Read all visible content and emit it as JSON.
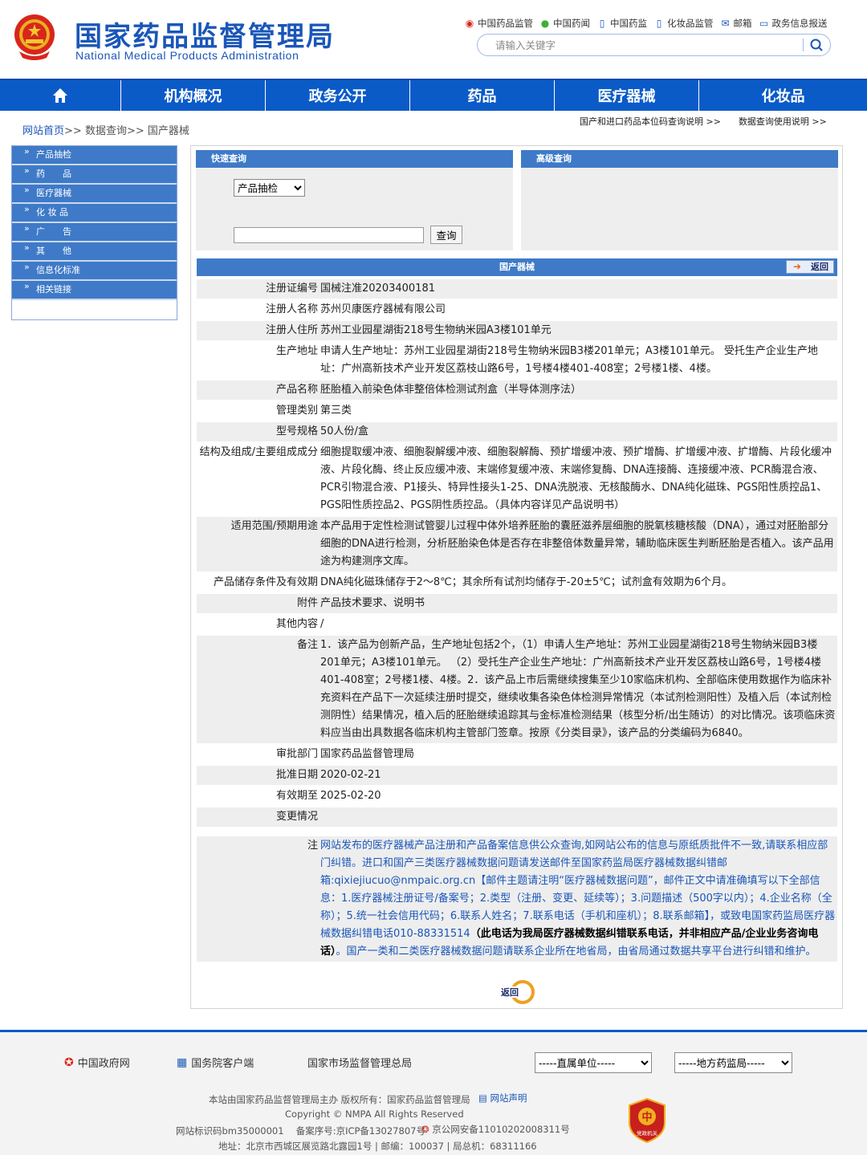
{
  "header": {
    "title_cn": "国家药品监督管理局",
    "title_en": "National Medical Products Administration",
    "top_links": [
      {
        "icon": "weibo-icon",
        "label": "中国药品监管"
      },
      {
        "icon": "wechat-icon",
        "label": "中国药闻"
      },
      {
        "icon": "phone-icon",
        "label": "中国药监"
      },
      {
        "icon": "phone-icon",
        "label": "化妆品监管"
      },
      {
        "icon": "mail-icon",
        "label": "邮箱"
      },
      {
        "icon": "monitor-icon",
        "label": "政务信息报送"
      }
    ],
    "search_placeholder": "请输入关键字"
  },
  "nav": {
    "items": [
      "机构概况",
      "政务公开",
      "药品",
      "医疗器械",
      "化妆品"
    ]
  },
  "breadcrumb": {
    "home": "网站首页",
    "sep": ">>",
    "level2": "数据查询",
    "level3": "国产器械"
  },
  "help_links": [
    "国产和进口药品本位码查询说明 >>",
    "数据查询使用说明 >>"
  ],
  "left_menu": [
    "产品抽检",
    "药　　品",
    "医疗器械",
    "化 妆 品",
    "广　　告",
    "其　　他",
    "信息化标准",
    "相关链接"
  ],
  "quick_search": {
    "title": "快速查询",
    "select_value": "产品抽检",
    "button": "查询"
  },
  "advanced_search": {
    "title": "高级查询"
  },
  "detail": {
    "title": "国产器械",
    "back_label": "返回",
    "rows": [
      {
        "label": "注册证编号",
        "value": "国械注准20203400181"
      },
      {
        "label": "注册人名称",
        "value": "苏州贝康医疗器械有限公司"
      },
      {
        "label": "注册人住所",
        "value": "苏州工业园星湖街218号生物纳米园A3楼101单元"
      },
      {
        "label": "生产地址",
        "value": "申请人生产地址：苏州工业园星湖街218号生物纳米园B3楼201单元；A3楼101单元。 受托生产企业生产地址：广州高新技术产业开发区荔枝山路6号，1号楼4楼401-408室；2号楼1楼、4楼。"
      },
      {
        "label": "产品名称",
        "value": "胚胎植入前染色体非整倍体检测试剂盒（半导体测序法）"
      },
      {
        "label": "管理类别",
        "value": "第三类"
      },
      {
        "label": "型号规格",
        "value": "50人份/盒"
      },
      {
        "label": "结构及组成/主要组成成分",
        "value": "细胞提取缓冲液、细胞裂解缓冲液、细胞裂解酶、预扩增缓冲液、预扩增酶、扩增缓冲液、扩增酶、片段化缓冲液、片段化酶、终止反应缓冲液、末端修复缓冲液、末端修复酶、DNA连接酶、连接缓冲液、PCR酶混合液、PCR引物混合液、P1接头、特异性接头1-25、DNA洗脱液、无核酸酶水、DNA纯化磁珠、PGS阳性质控品1、PGS阳性质控品2、PGS阴性质控品。（具体内容详见产品说明书）"
      },
      {
        "label": "适用范围/预期用途",
        "value": "本产品用于定性检测试管婴儿过程中体外培养胚胎的囊胚滋养层细胞的脱氧核糖核酸（DNA），通过对胚胎部分细胞的DNA进行检测，分析胚胎染色体是否存在非整倍体数量异常，辅助临床医生判断胚胎是否植入。该产品用途为构建测序文库。"
      },
      {
        "label": "产品储存条件及有效期",
        "value": "DNA纯化磁珠储存于2～8℃；其余所有试剂均储存于-20±5℃；试剂盒有效期为6个月。"
      },
      {
        "label": "附件",
        "value": "产品技术要求、说明书"
      },
      {
        "label": "其他内容",
        "value": "/"
      },
      {
        "label": "备注",
        "value": "1．该产品为创新产品，生产地址包括2个，（1）申请人生产地址：苏州工业园星湖街218号生物纳米园B3楼201单元；A3楼101单元。 （2）受托生产企业生产地址：广州高新技术产业开发区荔枝山路6号，1号楼4楼401-408室；2号楼1楼、4楼。2．该产品上市后需继续搜集至少10家临床机构、全部临床使用数据作为临床补充资料在产品下一次延续注册时提交，继续收集各染色体检测异常情况（本试剂检测阳性）及植入后（本试剂检测阴性）结果情况，植入后的胚胎继续追踪其与金标准检测结果（核型分析/出生随访）的对比情况。该项临床资料应当由出具数据各临床机构主管部门签章。按原《分类目录》，该产品的分类编码为6840。"
      },
      {
        "label": "审批部门",
        "value": "国家药品监督管理局"
      },
      {
        "label": "批准日期",
        "value": "2020-02-21"
      },
      {
        "label": "有效期至",
        "value": "2025-02-20"
      },
      {
        "label": "变更情况",
        "value": ""
      }
    ],
    "note_label": "注",
    "note_part1": "网站发布的医疗器械产品注册和产品备案信息供公众查询,如网站公布的信息与原纸质批件不一致,请联系相应部门纠错。进口和国产三类医疗器械数据问题请发送邮件至国家药监局医疗器械数据纠错邮箱:qixiejiucuo@nmpaic.org.cn【邮件主题请注明“医疗器械数据问题”，邮件正文中请准确填写以下全部信息：1.医疗器械注册证号/备案号；2.类型（注册、变更、延续等）；3.问题描述（500字以内）；4.企业名称（全称）；5.统一社会信用代码；6.联系人姓名；7.联系电话（手机和座机）；8.联系邮箱】，或致电国家药监局医疗器械数据纠错电话010-88331514",
    "note_bold": "（此电话为我局医疗器械数据纠错联系电话，并非相应产品/企业业务咨询电话）",
    "note_part2": "。国产一类和二类医疗器械数据问题请联系企业所在地省局，由省局通过数据共享平台进行纠错和维护。",
    "bottom_back": "返回"
  },
  "footer": {
    "links": [
      "中国政府网",
      "国务院客户端",
      "国家市场监督管理总局"
    ],
    "select1": "-----直属单位-----",
    "select2": "-----地方药监局-----",
    "line1": "本站由国家药品监督管理局主办  版权所有：国家药品监督管理局",
    "statement": "网站声明",
    "line2": "Copyright © NMPA All Rights Reserved",
    "line3a": "网站标识码bm35000001　 备案序号:京ICP备13027807号",
    "line3b": "京公网安备11010202008311号",
    "line4": "地址：北京市西城区展览路北露园1号 | 邮编：100037 | 局总机：68311166",
    "badge_text": "党政机关"
  },
  "colors": {
    "brand_blue": "#0a5bc8",
    "bar_blue": "#3f7ac8",
    "logo_blue": "#1a56b8"
  }
}
